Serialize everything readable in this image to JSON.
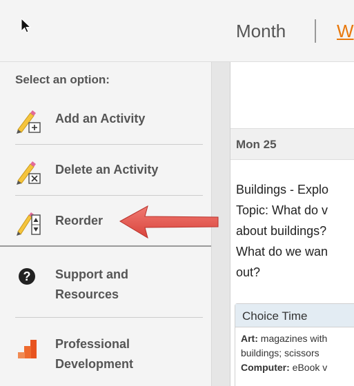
{
  "header": {
    "tab_month": "Month",
    "tab_week": "W"
  },
  "sidebar": {
    "heading": "Select an option:",
    "items": [
      {
        "label": "Add an Activity",
        "icon": "pencil-plus-icon"
      },
      {
        "label": "Delete an Activity",
        "icon": "pencil-x-icon"
      },
      {
        "label": "Reorder",
        "icon": "pencil-reorder-icon"
      }
    ],
    "support": {
      "line1": "Support and",
      "line2": "Resources",
      "icon": "question-circle-icon"
    },
    "pd": {
      "line1": "Professional",
      "line2": "Development",
      "icon": "steps-icon"
    }
  },
  "main": {
    "day_header": "Mon 25",
    "topic_lines": [
      "Buildings - Explo",
      "Topic: What do v",
      "about buildings?",
      "What do we wan",
      "out?"
    ],
    "choice_title": "Choice Time",
    "choice_lines": [
      {
        "label": "Art:",
        "text": " magazines with"
      },
      {
        "label": "",
        "text": "buildings; scissors"
      },
      {
        "label": "Computer:",
        "text": " eBook v"
      }
    ]
  },
  "colors": {
    "accent": "#e8780c",
    "arrow": "#e5534b",
    "pd_icon": "#e8531f"
  }
}
